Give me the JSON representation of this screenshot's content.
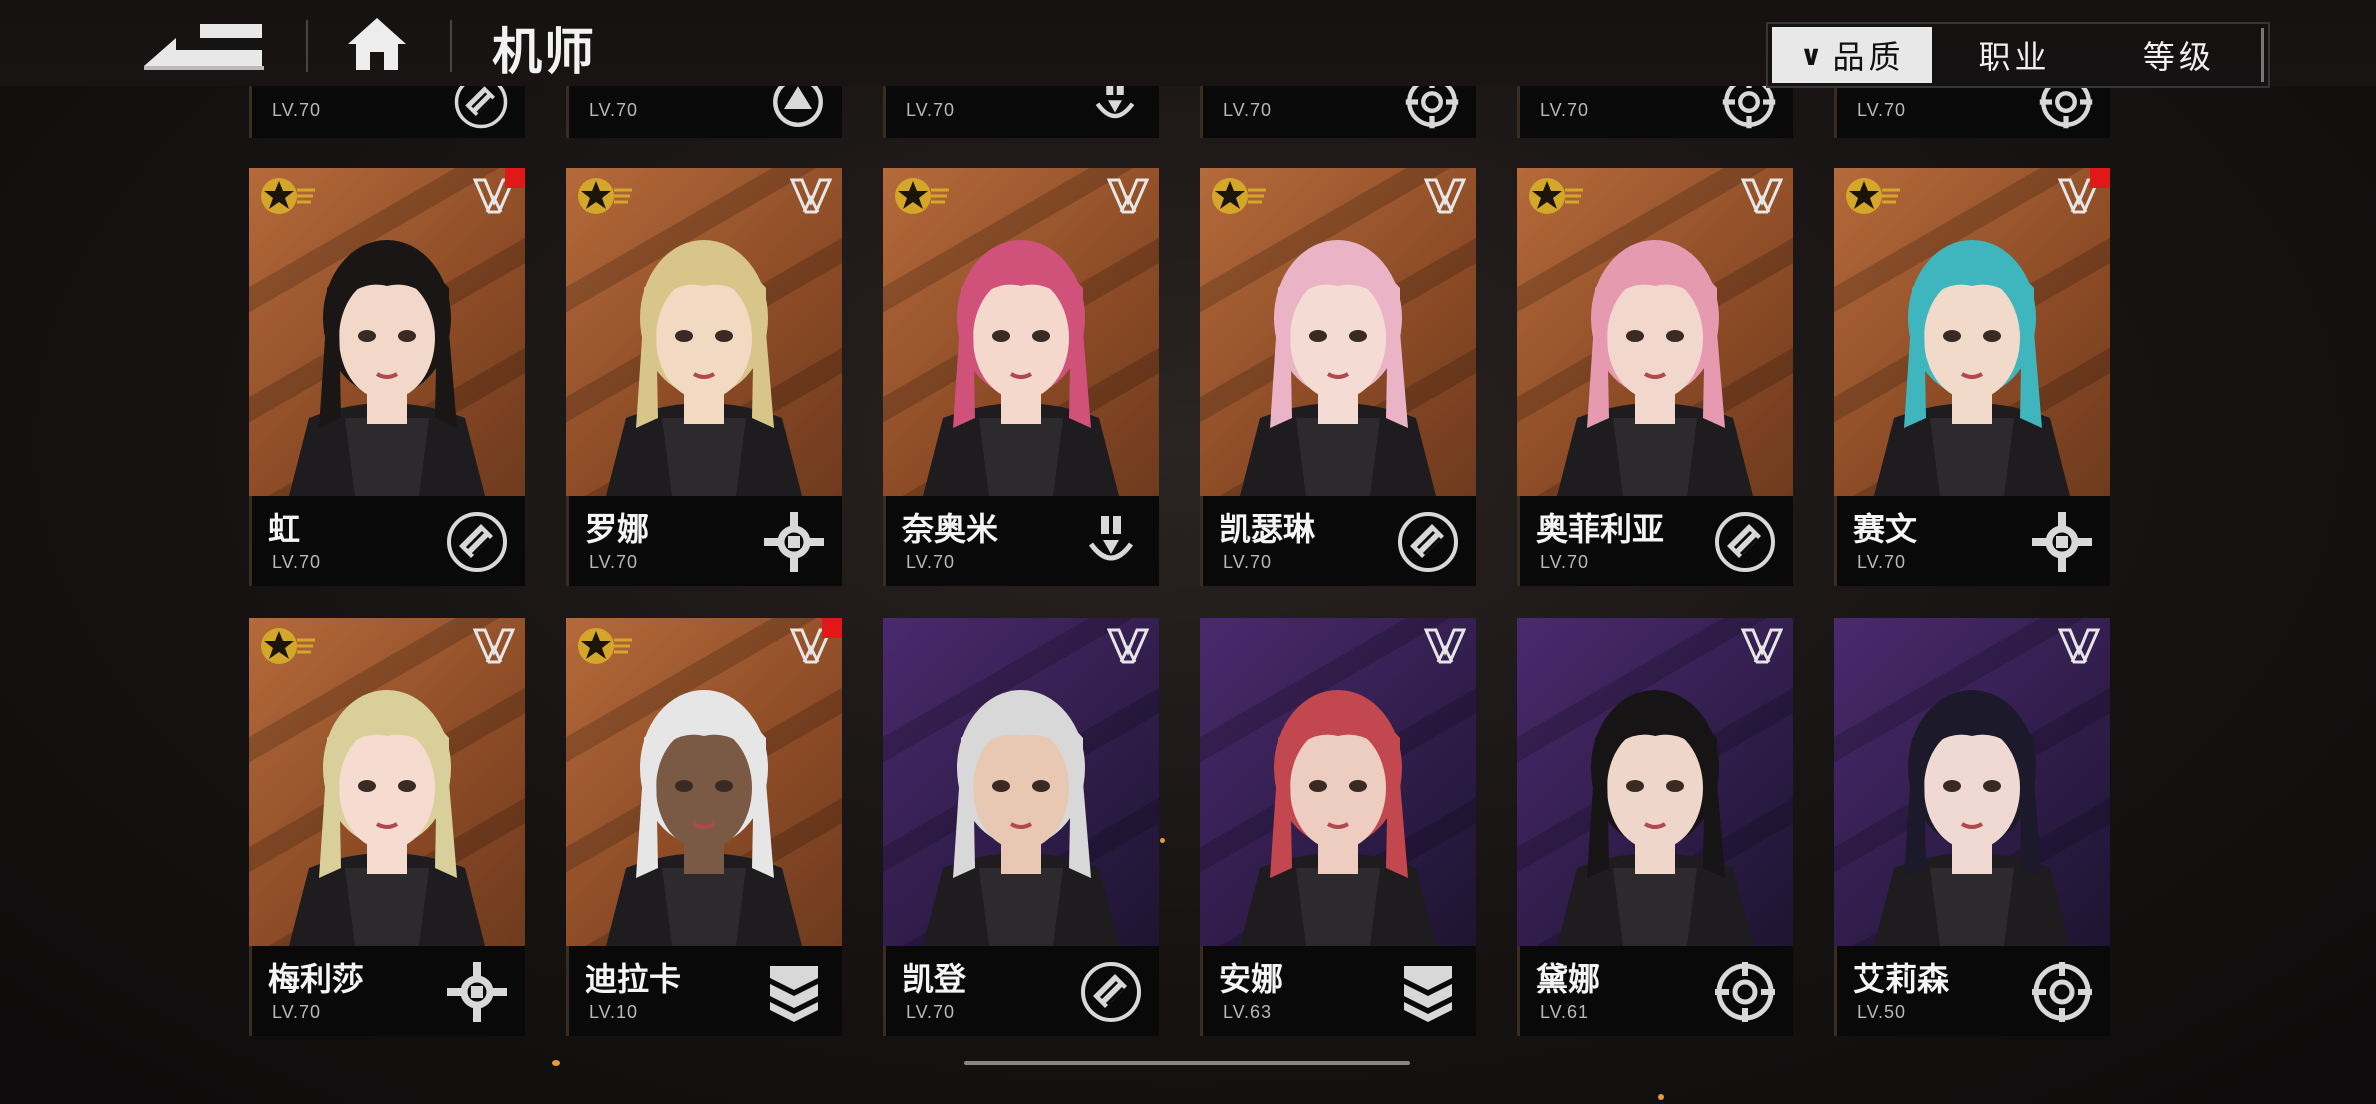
{
  "header": {
    "title": "机师",
    "back_icon": "back-arrow-icon",
    "home_icon": "home-icon"
  },
  "sort": {
    "tabs": [
      {
        "label": "品质",
        "active": true,
        "icon": "chevron-down-icon"
      },
      {
        "label": "职业",
        "active": false
      },
      {
        "label": "等级",
        "active": false
      }
    ]
  },
  "partial_row": [
    {
      "level": "LV.70",
      "role": "assault"
    },
    {
      "level": "LV.70",
      "role": "support"
    },
    {
      "level": "LV.70",
      "role": "sniper"
    },
    {
      "level": "LV.70",
      "role": "recon"
    },
    {
      "level": "LV.70",
      "role": "recon"
    },
    {
      "level": "LV.70",
      "role": "recon"
    }
  ],
  "pilots": [
    {
      "name": "虹",
      "level": "LV.70",
      "rarity": "gold",
      "role": "assault",
      "is_new": true,
      "hair": "#1a1616",
      "skin": "#f1d8c9"
    },
    {
      "name": "罗娜",
      "level": "LV.70",
      "rarity": "gold",
      "role": "engineer",
      "is_new": false,
      "hair": "#d8c58a",
      "skin": "#f2d9c2"
    },
    {
      "name": "奈奥米",
      "level": "LV.70",
      "rarity": "gold",
      "role": "sniper",
      "is_new": false,
      "hair": "#d0527a",
      "skin": "#f3d8cb"
    },
    {
      "name": "凯瑟琳",
      "level": "LV.70",
      "rarity": "gold",
      "role": "assault",
      "is_new": false,
      "hair": "#eab4c6",
      "skin": "#f4dcd4"
    },
    {
      "name": "奥菲利亚",
      "level": "LV.70",
      "rarity": "gold",
      "role": "assault",
      "is_new": false,
      "hair": "#e59ab0",
      "skin": "#f2d8cc"
    },
    {
      "name": "赛文",
      "level": "LV.70",
      "rarity": "gold",
      "role": "engineer",
      "is_new": true,
      "hair": "#3fb6bd",
      "skin": "#f2dacb"
    },
    {
      "name": "梅利莎",
      "level": "LV.70",
      "rarity": "gold",
      "role": "engineer",
      "is_new": false,
      "hair": "#d9cf9a",
      "skin": "#f6dcd0"
    },
    {
      "name": "迪拉卡",
      "level": "LV.10",
      "rarity": "gold",
      "role": "defender",
      "is_new": true,
      "hair": "#e6e6e6",
      "skin": "#7a5a44"
    },
    {
      "name": "凯登",
      "level": "LV.70",
      "rarity": "purple",
      "role": "assault",
      "is_new": false,
      "hair": "#d8d8d8",
      "skin": "#e8c8b2"
    },
    {
      "name": "安娜",
      "level": "LV.63",
      "rarity": "purple",
      "role": "defender",
      "is_new": false,
      "hair": "#c2474e",
      "skin": "#eccdbf"
    },
    {
      "name": "黛娜",
      "level": "LV.61",
      "rarity": "purple",
      "role": "recon",
      "is_new": false,
      "hair": "#161414",
      "skin": "#eed6cb"
    },
    {
      "name": "艾莉森",
      "level": "LV.50",
      "rarity": "purple",
      "role": "recon",
      "is_new": false,
      "hair": "#1c1a2a",
      "skin": "#f0d9d2"
    }
  ]
}
